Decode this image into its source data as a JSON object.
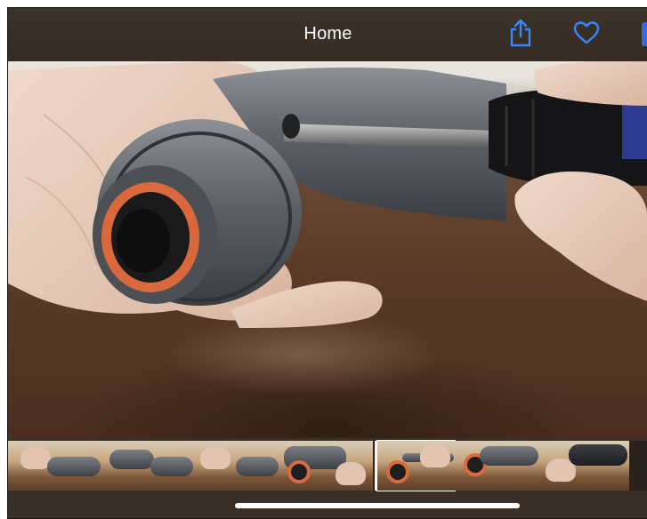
{
  "toolbar": {
    "title": "Home",
    "share_icon": "share-icon",
    "favorite_icon": "heart-icon",
    "accent_color": "#2f7bf5"
  },
  "photo": {
    "subject": "massage-gun-screwdriver-photo"
  },
  "filmstrip": {
    "thumb_count": 7,
    "current_index": 4
  },
  "colors": {
    "bar_background": "#3a3028",
    "ring_orange": "#d96a3f"
  }
}
